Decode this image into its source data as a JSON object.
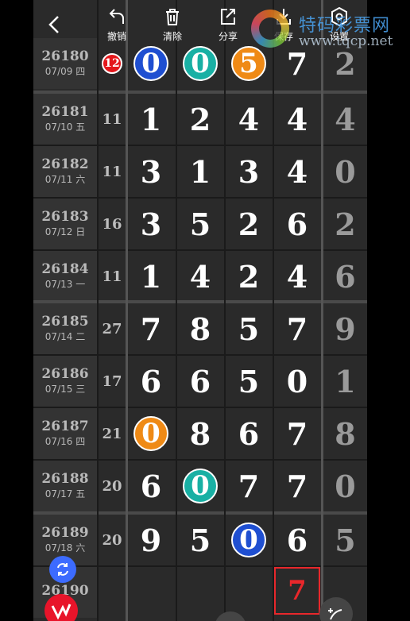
{
  "toolbar": {
    "undo_label": "撤销",
    "clear_label": "清除",
    "share_label": "分享",
    "save_label": "保存",
    "settings_label": "设置"
  },
  "watermark": {
    "name": "特码彩票网",
    "url": "www.tqcp.net"
  },
  "rows": [
    {
      "issue": "26180",
      "date": "07/09 四",
      "sum": "12",
      "n": [
        "0",
        "0",
        "5",
        "7"
      ],
      "last": "2"
    },
    {
      "issue": "26181",
      "date": "07/10 五",
      "sum": "11",
      "n": [
        "1",
        "2",
        "4",
        "4"
      ],
      "last": "4"
    },
    {
      "issue": "26182",
      "date": "07/11 六",
      "sum": "11",
      "n": [
        "3",
        "1",
        "3",
        "4"
      ],
      "last": "0"
    },
    {
      "issue": "26183",
      "date": "07/12 日",
      "sum": "16",
      "n": [
        "3",
        "5",
        "2",
        "6"
      ],
      "last": "2"
    },
    {
      "issue": "26184",
      "date": "07/13 一",
      "sum": "11",
      "n": [
        "1",
        "4",
        "2",
        "4"
      ],
      "last": "6"
    },
    {
      "issue": "26185",
      "date": "07/14 二",
      "sum": "27",
      "n": [
        "7",
        "8",
        "5",
        "7"
      ],
      "last": "9"
    },
    {
      "issue": "26186",
      "date": "07/15 三",
      "sum": "17",
      "n": [
        "6",
        "6",
        "5",
        "0"
      ],
      "last": "1"
    },
    {
      "issue": "26187",
      "date": "07/16 四",
      "sum": "21",
      "n": [
        "0",
        "8",
        "6",
        "7"
      ],
      "last": "8"
    },
    {
      "issue": "26188",
      "date": "07/17 五",
      "sum": "20",
      "n": [
        "6",
        "0",
        "7",
        "7"
      ],
      "last": "0"
    },
    {
      "issue": "26189",
      "date": "07/18 六",
      "sum": "20",
      "n": [
        "9",
        "5",
        "0",
        "6"
      ],
      "last": "5"
    }
  ],
  "next": {
    "issue": "26190",
    "selected": "7"
  },
  "colors": {
    "blue": "#1f4fd1",
    "teal": "#19b0a4",
    "orange": "#ef8a16",
    "red": "#e8272b"
  }
}
